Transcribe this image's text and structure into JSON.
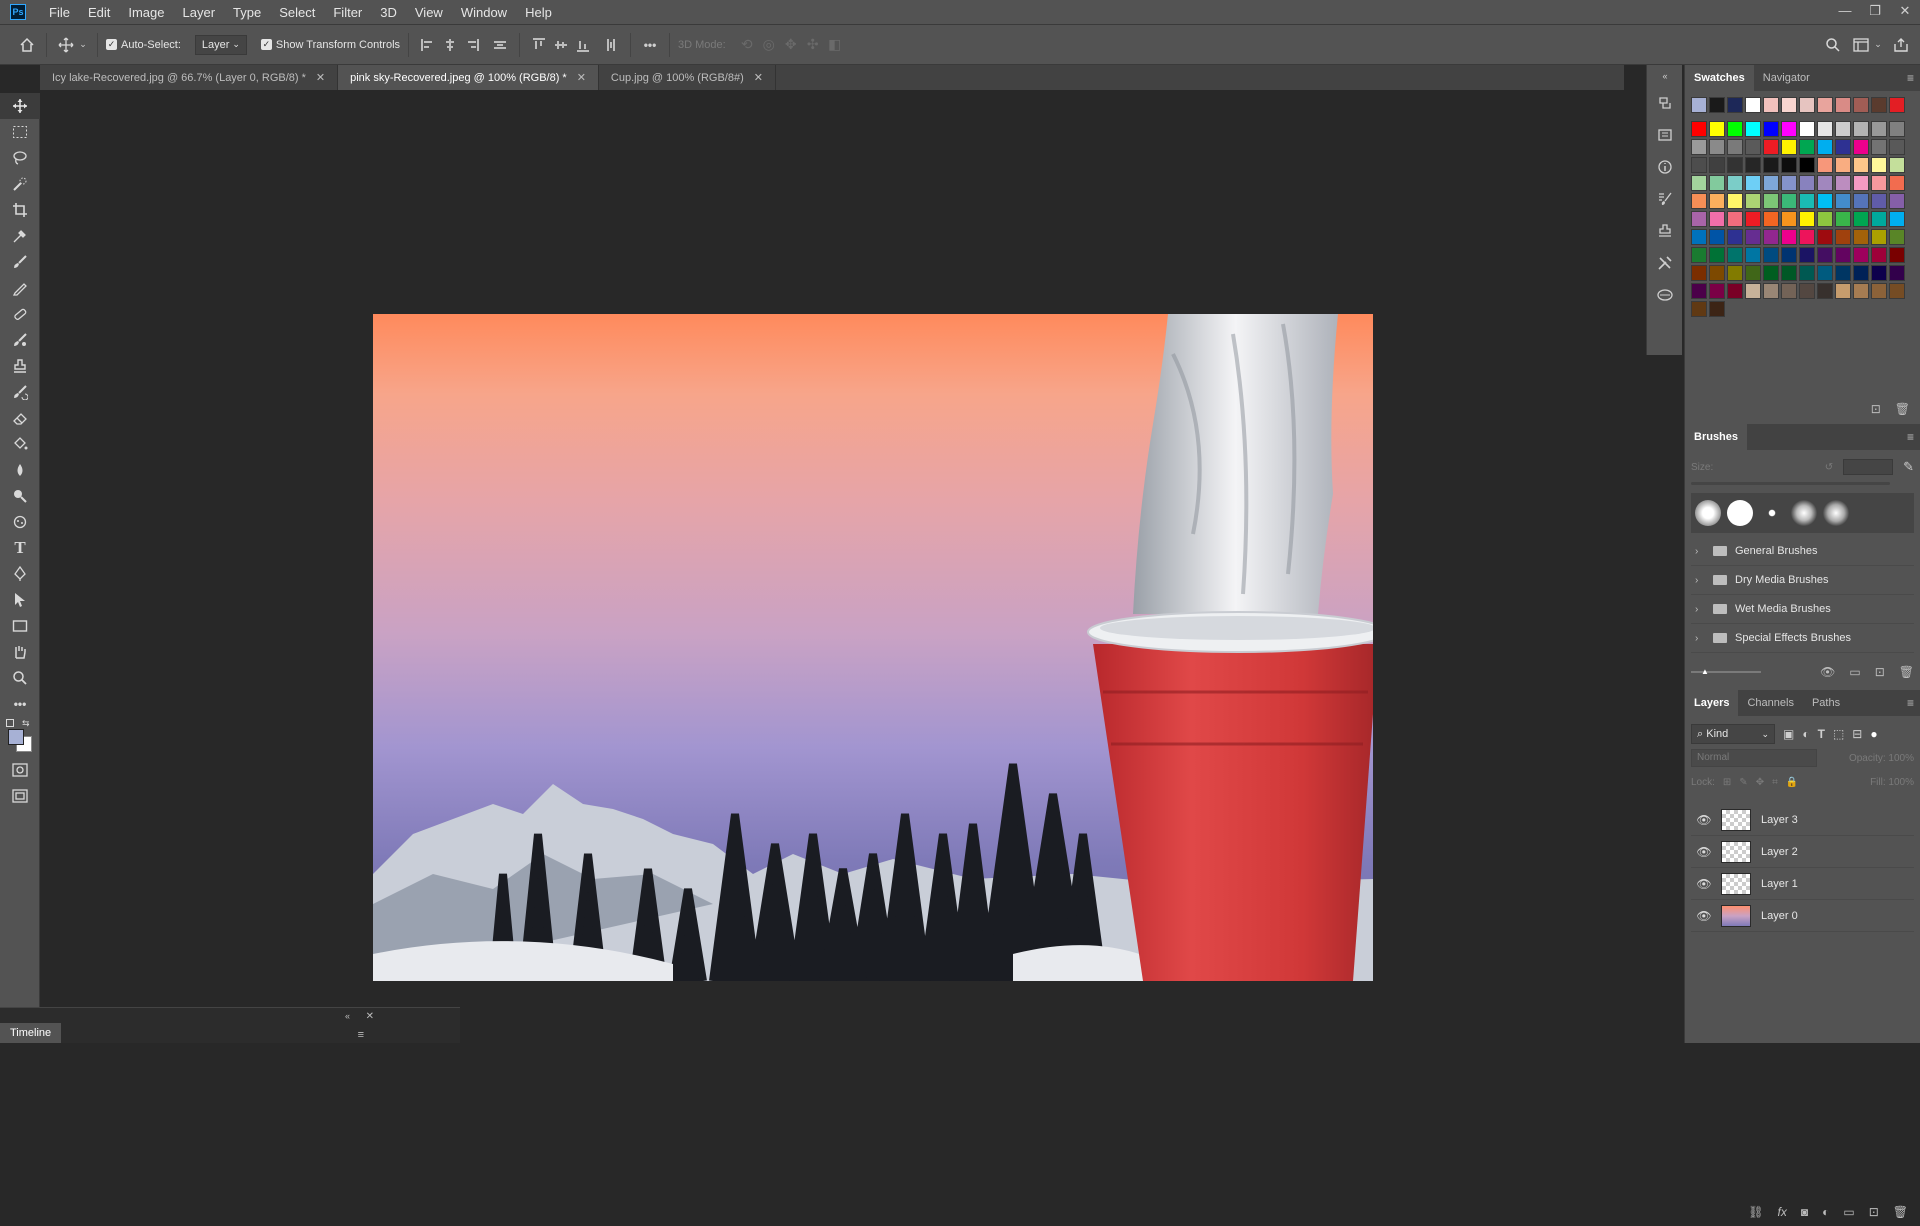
{
  "app": {
    "logo": "Ps",
    "menu": [
      "File",
      "Edit",
      "Image",
      "Layer",
      "Type",
      "Select",
      "Filter",
      "3D",
      "View",
      "Window",
      "Help"
    ],
    "window_controls": [
      "—",
      "❐",
      "✕"
    ]
  },
  "options_bar": {
    "auto_select_label": "Auto-Select:",
    "auto_select_target": "Layer",
    "show_transform_label": "Show Transform Controls",
    "mode_3d_label": "3D Mode:",
    "more": "•••"
  },
  "tabs": [
    {
      "label": "Icy lake-Recovered.jpg @ 66.7% (Layer 0, RGB/8) *",
      "active": false
    },
    {
      "label": "pink sky-Recovered.jpeg @ 100% (RGB/8) *",
      "active": true
    },
    {
      "label": "Cup.jpg @ 100% (RGB/8#)",
      "active": false
    }
  ],
  "tools": [
    "move-tool",
    "marquee-tool",
    "lasso-tool",
    "quick-select-tool",
    "crop-tool",
    "eyedropper-tool",
    "healing-brush-tool",
    "brush-tool",
    "clone-stamp-tool",
    "history-brush-tool",
    "eraser-tool",
    "paint-bucket-tool",
    "blur-tool",
    "dodge-tool",
    "pen-tool",
    "type-tool",
    "path-select-tool",
    "rectangle-tool",
    "hand-tool",
    "zoom-tool"
  ],
  "timeline": {
    "label": "Timeline"
  },
  "swatches_panel": {
    "tabs": [
      "Swatches",
      "Navigator"
    ],
    "recent": [
      "#a7b1d5",
      "#1a1a1a",
      "#1d2858",
      "#ffffff",
      "#f2c1bd",
      "#f8d5d0",
      "#e6c4c0",
      "#e8a49d",
      "#d98b86",
      "#a15d55",
      "#5a3b2e",
      "#e31e24"
    ],
    "grid": [
      [
        "#ff0000",
        "#ffff00",
        "#00ff00",
        "#00ffff",
        "#0000ff",
        "#ff00ff",
        "#ffffff",
        "#e6e6e6",
        "#cccccc",
        "#b3b3b3",
        "#999999",
        "#808080"
      ],
      [
        "#9a9a9a",
        "#8a8a8a",
        "#7a7a7a",
        "#5a5a5a",
        "#ed1c24",
        "#fff200",
        "#00a651",
        "#00aeef",
        "#2e3192",
        "#ec008c",
        "#737373",
        "#595959"
      ],
      [
        "#4d4d4d",
        "#404040",
        "#333333",
        "#262626",
        "#1a1a1a",
        "#0d0d0d",
        "#000000",
        "#f7977a",
        "#f9ad81",
        "#fdc68a",
        "#fff79a",
        "#c4df9b"
      ],
      [
        "#a3d39c",
        "#82ca9d",
        "#7bcdc8",
        "#6ecff6",
        "#7ea7d8",
        "#8493ca",
        "#8882be",
        "#a187be",
        "#bc8dbf",
        "#f49ac2",
        "#f6989d",
        "#f26c4f"
      ],
      [
        "#f68e56",
        "#fbaf5d",
        "#fff568",
        "#acd373",
        "#7cc576",
        "#3bb878",
        "#1abbb4",
        "#00bff3",
        "#438cca",
        "#5574b9",
        "#605ca8",
        "#855fa8"
      ],
      [
        "#a864a8",
        "#f06ea9",
        "#f26d7d",
        "#ed1c24",
        "#f26522",
        "#f7941d",
        "#fff200",
        "#8dc63f",
        "#39b54a",
        "#00a651",
        "#00a99d",
        "#00aeef"
      ],
      [
        "#0072bc",
        "#0054a6",
        "#2e3192",
        "#662d91",
        "#92278f",
        "#ec008c",
        "#ed145b",
        "#9e0b0f",
        "#a0410d",
        "#a3620a",
        "#aba000",
        "#598527"
      ],
      [
        "#1a7b30",
        "#007236",
        "#00746b",
        "#0076a3",
        "#004b80",
        "#003471",
        "#1b1464",
        "#440e62",
        "#630460",
        "#9e005d",
        "#9e0039",
        "#790000"
      ],
      [
        "#7b2e00",
        "#7d4900",
        "#827b00",
        "#406618",
        "#005e20",
        "#005826",
        "#005952",
        "#005b7f",
        "#003663",
        "#002157",
        "#0d004c",
        "#32004b"
      ],
      [
        "#4b0049",
        "#7b0046",
        "#7a0026",
        "#c7b299",
        "#998675",
        "#736357",
        "#534741",
        "#37302d",
        "#c69c6d",
        "#a67c52",
        "#8c6239",
        "#754c24"
      ],
      [
        "#603913",
        "#3c2415"
      ]
    ]
  },
  "brushes_panel": {
    "title": "Brushes",
    "size_label": "Size:",
    "groups": [
      "General Brushes",
      "Dry Media Brushes",
      "Wet Media Brushes",
      "Special Effects Brushes"
    ]
  },
  "layers_panel": {
    "tabs": [
      "Layers",
      "Channels",
      "Paths"
    ],
    "kind_label": "Kind",
    "blend_mode": "Normal",
    "opacity_label": "Opacity:",
    "opacity_value": "100%",
    "lock_label": "Lock:",
    "fill_label": "Fill:",
    "fill_value": "100%",
    "layers": [
      {
        "name": "Layer 3",
        "thumb": "transparent"
      },
      {
        "name": "Layer 2",
        "thumb": "transparent"
      },
      {
        "name": "Layer 1",
        "thumb": "transparent"
      },
      {
        "name": "Layer 0",
        "thumb": "sky"
      }
    ]
  }
}
